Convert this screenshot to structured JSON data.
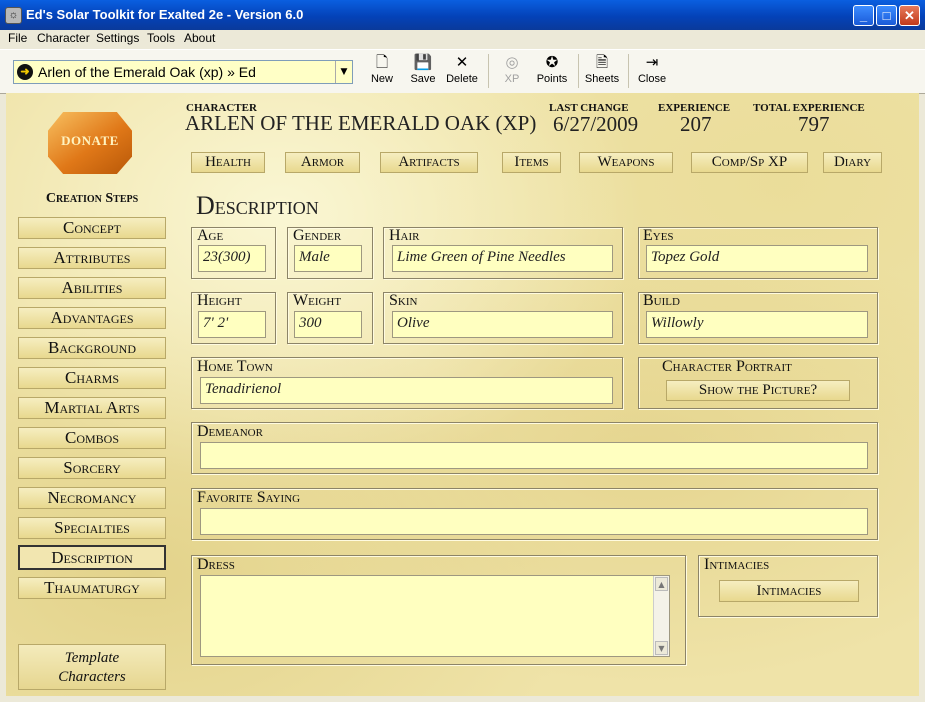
{
  "window": {
    "title": "Ed's Solar Toolkit for Exalted 2e - Version 6.0"
  },
  "menu": [
    "File",
    "Character",
    "Settings",
    "Tools",
    "About"
  ],
  "toolbar": {
    "character_select": "Arlen of the Emerald Oak (xp) » Ed",
    "new": "New",
    "save": "Save",
    "delete": "Delete",
    "xp": "XP",
    "points": "Points",
    "sheets": "Sheets",
    "close": "Close"
  },
  "donate": "DONATE",
  "creation_steps": {
    "heading": "Creation Steps",
    "items": [
      "Concept",
      "Attributes",
      "Abilities",
      "Advantages",
      "Background",
      "Charms",
      "Martial Arts",
      "Combos",
      "Sorcery",
      "Necromancy",
      "Specialties",
      "Description",
      "Thaumaturgy"
    ],
    "selected": "Description"
  },
  "template_button": {
    "line1": "Template",
    "line2": "Characters"
  },
  "header": {
    "character_label": "CHARACTER",
    "character_name": "ARLEN OF THE EMERALD OAK (XP)",
    "last_change_label": "LAST CHANGE",
    "last_change": "6/27/2009",
    "experience_label": "EXPERIENCE",
    "experience": "207",
    "total_experience_label": "TOTAL EXPERIENCE",
    "total_experience": "797"
  },
  "tabs": [
    "Health",
    "Armor",
    "Artifacts",
    "Items",
    "Weapons",
    "Comp/Sp XP",
    "Diary"
  ],
  "description": {
    "title": "Description",
    "age_label": "Age",
    "age": "23(300)",
    "gender_label": "Gender",
    "gender": "Male",
    "hair_label": "Hair",
    "hair": "Lime Green of Pine Needles",
    "eyes_label": "Eyes",
    "eyes": "Topez Gold",
    "height_label": "Height",
    "height": "7' 2'",
    "weight_label": "Weight",
    "weight": "300",
    "skin_label": "Skin",
    "skin": "Olive",
    "build_label": "Build",
    "build": "Willowly",
    "hometown_label": "Home Town",
    "hometown": "Tenadirienol",
    "portrait_label": "Character Portrait",
    "portrait_button": "Show the Picture?",
    "demeanor_label": "Demeanor",
    "demeanor": "",
    "saying_label": "Favorite Saying",
    "saying": "",
    "dress_label": "Dress",
    "dress": "",
    "intimacies_label": "Intimacies",
    "intimacies_button": "Intimacies"
  },
  "colors": {
    "field_bg": "#ffffc0",
    "parchment": "#efe3a8",
    "titlebar": "#0442b8"
  }
}
